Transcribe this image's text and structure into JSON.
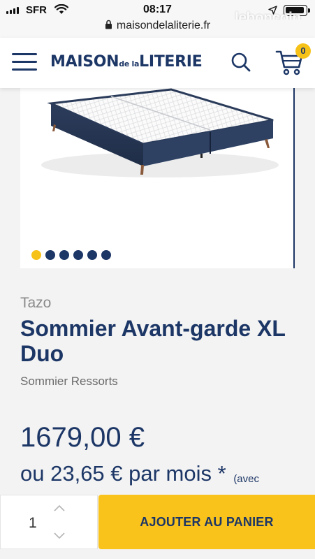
{
  "status_bar": {
    "carrier": "SFR",
    "time": "08:17",
    "watermark": "leboncoin"
  },
  "browser": {
    "url": "maisondelaliterie.fr"
  },
  "header": {
    "logo": {
      "part1": "MAISON",
      "part2": "de la",
      "part3": "LITERIE"
    },
    "cart_count": "0"
  },
  "gallery": {
    "image_alt": "Sommier Avant-garde XL Duo",
    "dot_count": 6,
    "active_dot": 1
  },
  "product": {
    "brand": "Tazo",
    "title": "Sommier Avant-garde XL Duo",
    "subtitle": "Sommier Ressorts",
    "price": "1679,00 €",
    "monthly": "ou 23,65 € par mois *",
    "monthly_note": "(avec"
  },
  "cart_bar": {
    "quantity": "1",
    "add_label": "AJOUTER AU PANIER"
  },
  "colors": {
    "navy": "#1c3666",
    "yellow": "#f9c31c"
  }
}
